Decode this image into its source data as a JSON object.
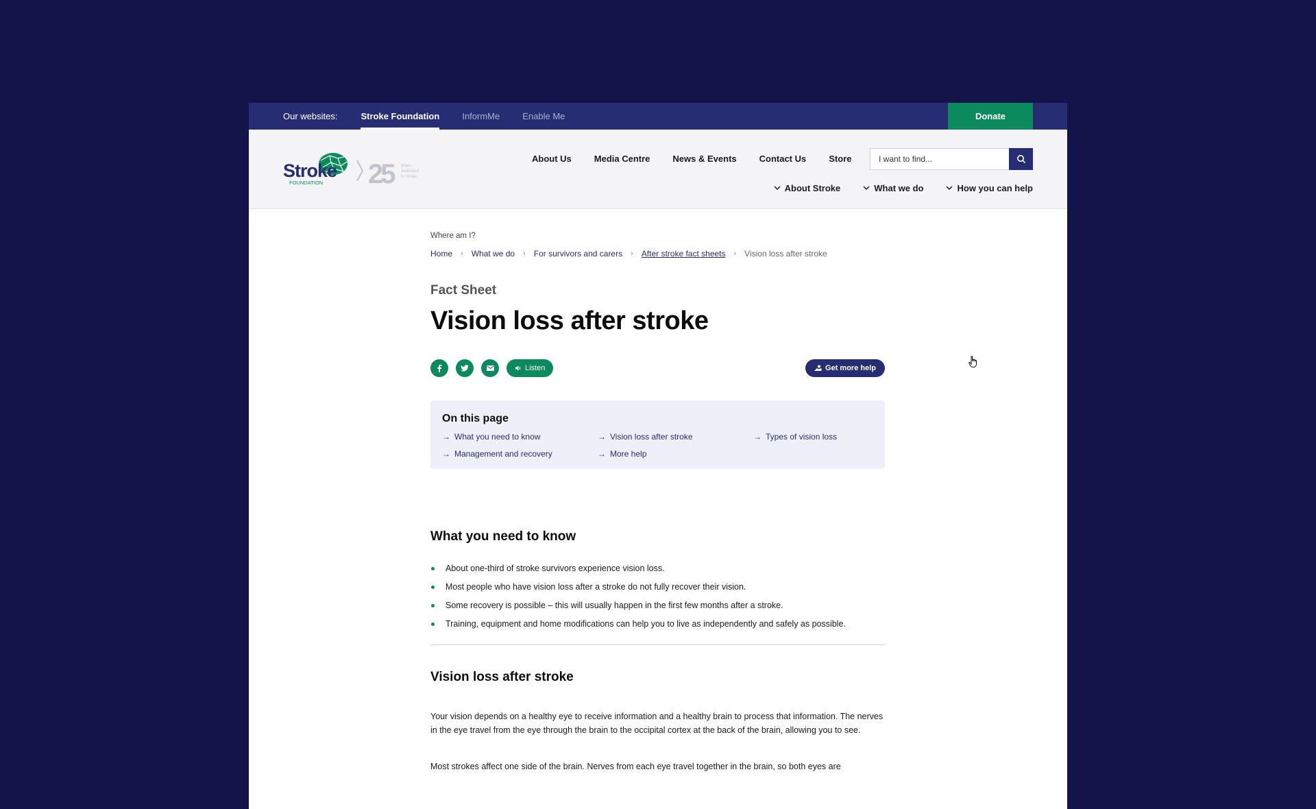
{
  "topbar": {
    "label": "Our websites:",
    "sites": [
      "Stroke Foundation",
      "InformMe",
      "Enable Me"
    ],
    "donate": "Donate"
  },
  "header": {
    "logo": {
      "word": "Stroke",
      "sub": "FOUNDATION",
      "years": "25",
      "years_text": [
        "years",
        "dedicated",
        "to stroke"
      ]
    },
    "nav": [
      "About Us",
      "Media Centre",
      "News & Events",
      "Contact Us",
      "Store"
    ],
    "search_placeholder": "I want to find...",
    "subnav": [
      "About Stroke",
      "What we do",
      "How you can help"
    ]
  },
  "breadcrumb": {
    "label": "Where am I?",
    "items": [
      "Home",
      "What we do",
      "For survivors and carers",
      "After stroke fact sheets"
    ],
    "current": "Vision loss after stroke"
  },
  "page": {
    "kicker": "Fact Sheet",
    "title": "Vision loss after stroke",
    "listen": "Listen",
    "get_help": "Get more help"
  },
  "on_this_page": {
    "heading": "On this page",
    "links": [
      "What you need to know",
      "Vision loss after stroke",
      "Types of vision loss",
      "Management and recovery",
      "More help"
    ]
  },
  "section1": {
    "heading": "What you need to know",
    "bullets": [
      "About one-third of stroke survivors experience vision loss.",
      "Most people who have vision loss after a stroke do not fully recover their vision.",
      "Some recovery is possible – this will usually happen in the first few months after a stroke.",
      "Training, equipment and home modifications can help you to live as independently and safely as possible."
    ]
  },
  "section2": {
    "heading": "Vision loss after stroke",
    "para1": "Your vision depends on a healthy eye to receive information and a healthy brain to process that information. The nerves in the eye travel from the eye through the brain to the occipital cortex at the back of the brain, allowing you to see.",
    "para2": "Most strokes affect one side of the brain. Nerves from each eye travel together in the brain, so both eyes are"
  },
  "colors": {
    "navy": "#262d72",
    "green": "#0b8a5e",
    "background": "#13144a"
  }
}
